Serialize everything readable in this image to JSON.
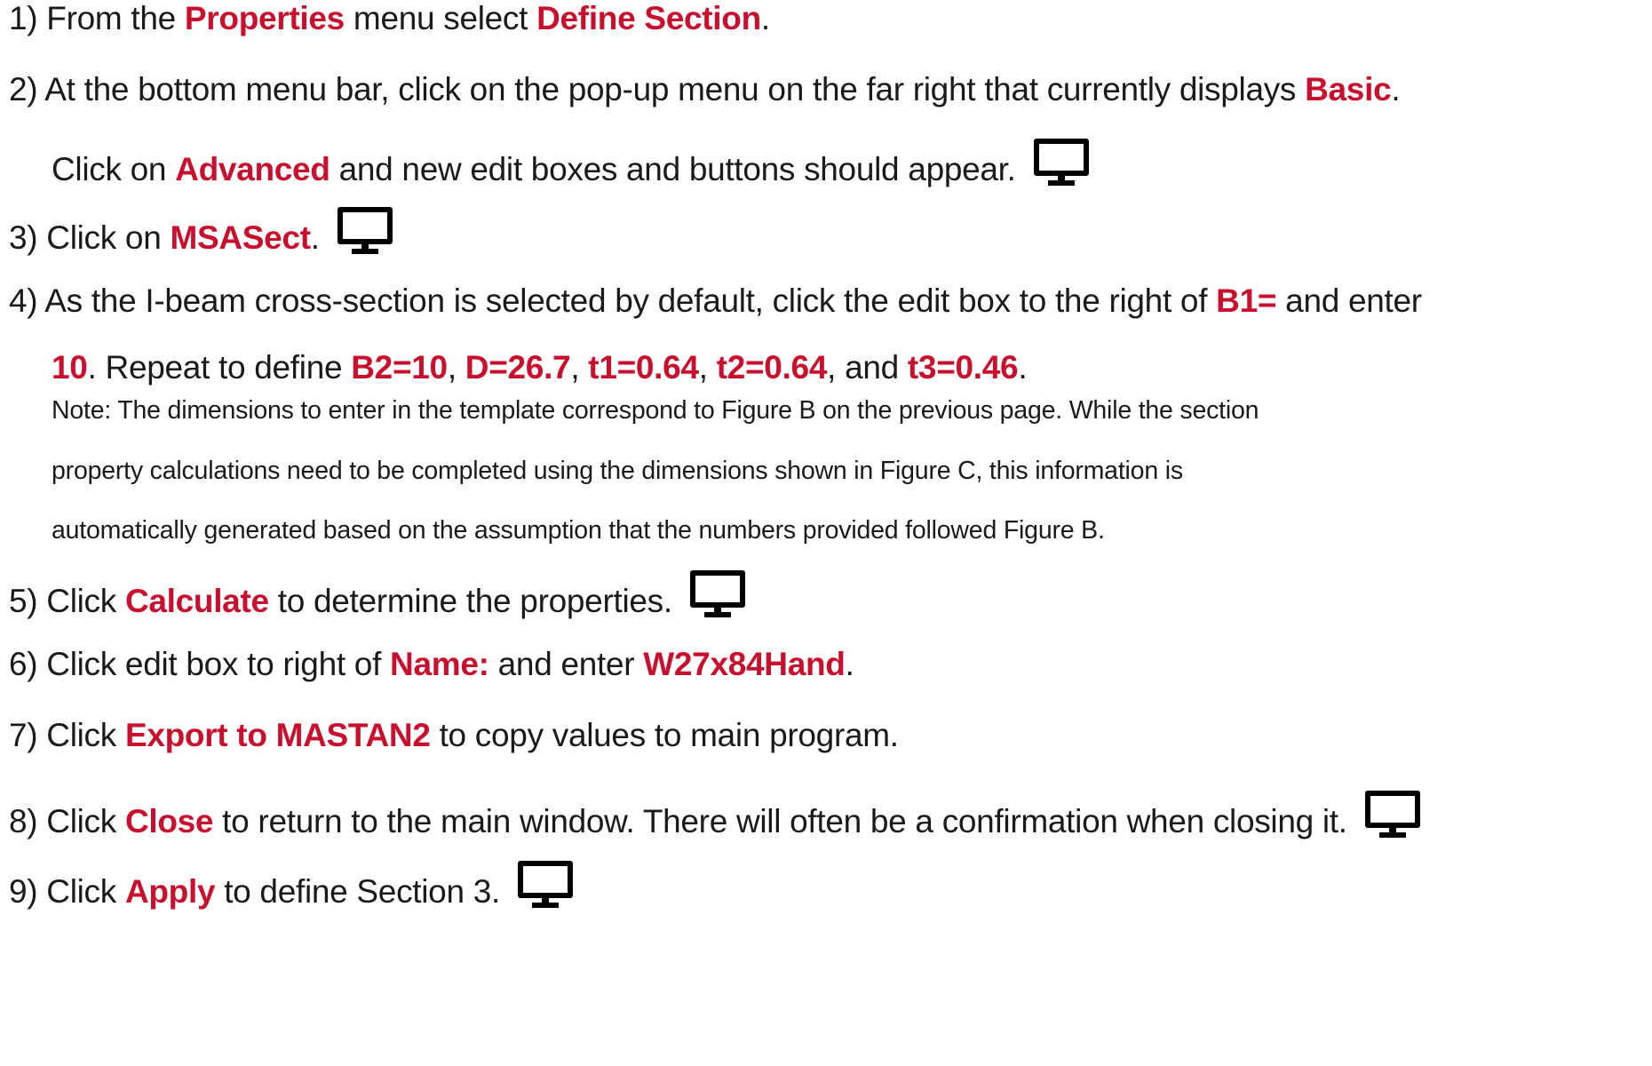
{
  "steps": [
    {
      "num": "1)",
      "parts": [
        {
          "t": "From the ",
          "hl": false
        },
        {
          "t": "Properties",
          "hl": true
        },
        {
          "t": " menu select ",
          "hl": false
        },
        {
          "t": "Define Section",
          "hl": true
        },
        {
          "t": ".",
          "hl": false
        }
      ]
    },
    {
      "num": "2)",
      "parts": [
        {
          "t": "At the bottom menu bar, click on the pop-up menu on the far right that currently displays ",
          "hl": false
        },
        {
          "t": "Basic",
          "hl": true
        },
        {
          "t": ".",
          "hl": false
        }
      ],
      "cont": [
        {
          "t": "Click on ",
          "hl": false
        },
        {
          "t": "Advanced",
          "hl": true
        },
        {
          "t": " and new edit boxes and buttons should appear.",
          "hl": false
        }
      ],
      "icon": "monitor-icon"
    },
    {
      "num": "3)",
      "parts": [
        {
          "t": "Click on ",
          "hl": false
        },
        {
          "t": "MSASect",
          "hl": true
        },
        {
          "t": ".",
          "hl": false
        }
      ],
      "icon": "monitor-icon"
    },
    {
      "num": "4)",
      "parts": [
        {
          "t": "As the I-beam cross-section is selected by default, click the edit box to the right of ",
          "hl": false
        },
        {
          "t": "B1=",
          "hl": true
        },
        {
          "t": " and enter",
          "hl": false
        }
      ],
      "cont": [
        {
          "t": "10",
          "hl": true
        },
        {
          "t": ". Repeat to define ",
          "hl": false
        },
        {
          "t": "B2=10",
          "hl": true
        },
        {
          "t": ", ",
          "hl": false
        },
        {
          "t": "D=26.7",
          "hl": true
        },
        {
          "t": ", ",
          "hl": false
        },
        {
          "t": "t1=0.64",
          "hl": true
        },
        {
          "t": ", ",
          "hl": false
        },
        {
          "t": "t2=0.64",
          "hl": true
        },
        {
          "t": ", and ",
          "hl": false
        },
        {
          "t": "t3=0.46",
          "hl": true
        },
        {
          "t": ".",
          "hl": false
        }
      ],
      "note": [
        "Note: The dimensions to enter in the template correspond to Figure B on the previous page. While the section",
        "property calculations need to be completed using the dimensions shown in Figure C, this information is",
        "automatically generated based on the assumption that the numbers provided followed Figure B."
      ]
    },
    {
      "num": "5)",
      "parts": [
        {
          "t": "Click ",
          "hl": false
        },
        {
          "t": "Calculate",
          "hl": true
        },
        {
          "t": " to determine the properties.",
          "hl": false
        }
      ],
      "icon": "monitor-icon"
    },
    {
      "num": "6)",
      "parts": [
        {
          "t": "Click edit box to right of ",
          "hl": false
        },
        {
          "t": "Name:",
          "hl": true
        },
        {
          "t": " and enter ",
          "hl": false
        },
        {
          "t": "W27x84Hand",
          "hl": true
        },
        {
          "t": ".",
          "hl": false
        }
      ]
    },
    {
      "num": "7)",
      "parts": [
        {
          "t": "Click ",
          "hl": false
        },
        {
          "t": "Export to MASTAN2",
          "hl": true
        },
        {
          "t": " to copy values to main program.",
          "hl": false
        }
      ]
    },
    {
      "num": "8)",
      "parts": [
        {
          "t": "Click ",
          "hl": false
        },
        {
          "t": "Close",
          "hl": true
        },
        {
          "t": " to return to the main window. There will often be a confirmation when closing it.",
          "hl": false
        }
      ],
      "icon": "monitor-icon"
    },
    {
      "num": "9)",
      "parts": [
        {
          "t": "Click ",
          "hl": false
        },
        {
          "t": "Apply",
          "hl": true
        },
        {
          "t": " to define Section 3.",
          "hl": false
        }
      ],
      "icon": "monitor-icon"
    }
  ],
  "colors": {
    "highlight": "#c8102e",
    "text": "#1a1a1a"
  }
}
